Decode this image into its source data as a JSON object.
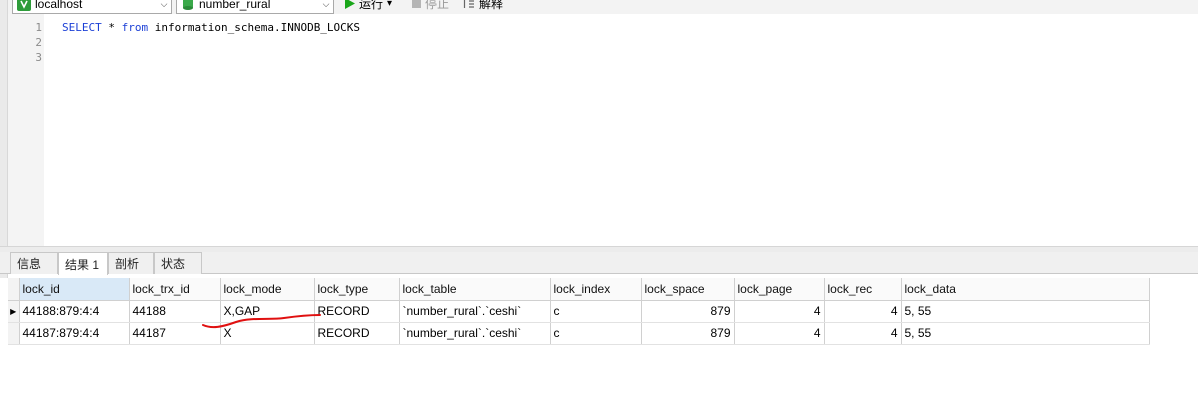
{
  "toolbar": {
    "connection": "localhost",
    "database": "number_rural",
    "run_label": "运行",
    "run_dropdown": "▾",
    "stop_label": "停止",
    "explain_label": "解释"
  },
  "editor": {
    "line_numbers": [
      "1",
      "2",
      "3"
    ],
    "sql": {
      "kw_select": "SELECT",
      "star": " * ",
      "kw_from": "from",
      "rest": " information_schema.INNODB_LOCKS"
    }
  },
  "tabs": [
    "信息",
    "结果 1",
    "剖析",
    "状态"
  ],
  "results": {
    "columns": [
      "lock_id",
      "lock_trx_id",
      "lock_mode",
      "lock_type",
      "lock_table",
      "lock_index",
      "lock_space",
      "lock_page",
      "lock_rec",
      "lock_data"
    ],
    "rows": [
      [
        "44188:879:4:4",
        "44188",
        "X,GAP",
        "RECORD",
        "`number_rural`.`ceshi`",
        "c",
        "879",
        "4",
        "4",
        "5, 55"
      ],
      [
        "44187:879:4:4",
        "44187",
        "X",
        "RECORD",
        "`number_rural`.`ceshi`",
        "c",
        "879",
        "4",
        "4",
        "5, 55"
      ]
    ]
  },
  "colors": {
    "keyword": "#1b3fd6",
    "annotation": "#e01010",
    "run_icon": "#1aa61a"
  }
}
